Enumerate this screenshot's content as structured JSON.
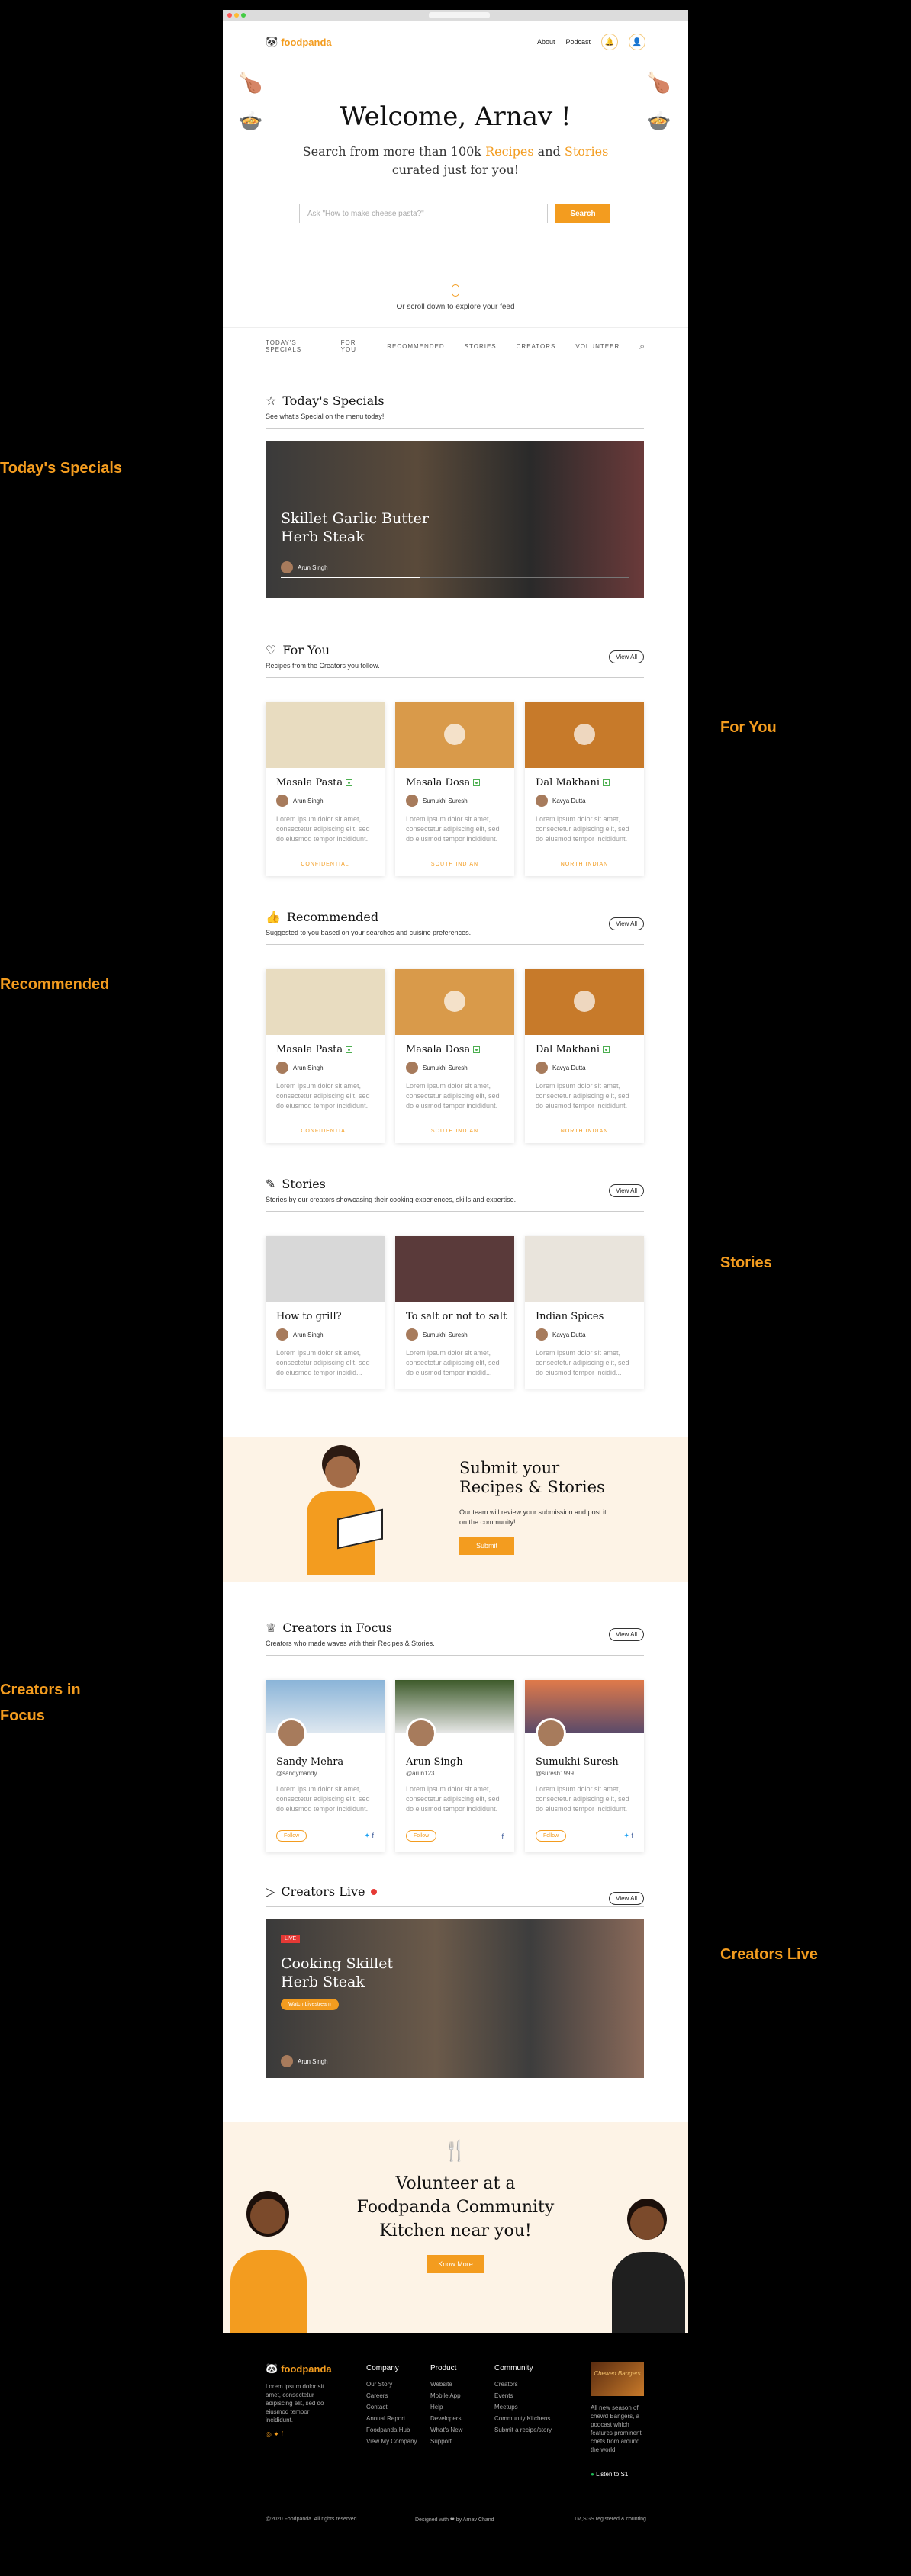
{
  "app": {
    "logo": "foodpanda",
    "nav_about": "About",
    "nav_podcast": "Podcast"
  },
  "hero": {
    "title": "Welcome, Arnav !",
    "line1_a": "Search from more than 100k ",
    "line1_b": "Recipes",
    "line1_c": " and ",
    "line1_d": "Stories",
    "line2": "curated just for you!",
    "search_placeholder": "Ask \"How to make cheese pasta?\"",
    "search_button": "Search",
    "scroll_hint": "Or scroll down to explore your feed"
  },
  "tabs": [
    "TODAY'S SPECIALS",
    "FOR YOU",
    "RECOMMENDED",
    "STORIES",
    "CREATORS",
    "VOLUNTEER"
  ],
  "specials": {
    "title": "Today's Specials",
    "subtitle": "See what's Special on the menu today!",
    "dish_line1": "Skillet Garlic Butter",
    "dish_line2": "Herb Steak",
    "author": "Arun Singh"
  },
  "view_all": "View All",
  "foryou": {
    "title": "For You",
    "subtitle": "Recipes from the Creators you follow.",
    "cards": [
      {
        "title": "Masala Pasta",
        "author": "Arun Singh",
        "desc": "Lorem ipsum dolor sit amet, consectetur adipiscing elit, sed do eiusmod tempor incididunt.",
        "tag": "CONFIDENTIAL"
      },
      {
        "title": "Masala Dosa",
        "author": "Sumukhi Suresh",
        "desc": "Lorem ipsum dolor sit amet, consectetur adipiscing elit, sed do eiusmod tempor incididunt.",
        "tag": "SOUTH INDIAN"
      },
      {
        "title": "Dal Makhani",
        "author": "Kavya Dutta",
        "desc": "Lorem ipsum dolor sit amet, consectetur adipiscing elit, sed do eiusmod tempor incididunt.",
        "tag": "NORTH INDIAN"
      }
    ]
  },
  "recommended": {
    "title": "Recommended",
    "subtitle": "Suggested to you based on your searches and cuisine preferences.",
    "cards": [
      {
        "title": "Masala Pasta",
        "author": "Arun Singh",
        "desc": "Lorem ipsum dolor sit amet, consectetur adipiscing elit, sed do eiusmod tempor incididunt.",
        "tag": "CONFIDENTIAL"
      },
      {
        "title": "Masala Dosa",
        "author": "Sumukhi Suresh",
        "desc": "Lorem ipsum dolor sit amet, consectetur adipiscing elit, sed do eiusmod tempor incididunt.",
        "tag": "SOUTH INDIAN"
      },
      {
        "title": "Dal Makhani",
        "author": "Kavya Dutta",
        "desc": "Lorem ipsum dolor sit amet, consectetur adipiscing elit, sed do eiusmod tempor incididunt.",
        "tag": "NORTH INDIAN"
      }
    ]
  },
  "stories": {
    "title": "Stories",
    "subtitle": "Stories by our creators showcasing their cooking experiences, skills and expertise.",
    "cards": [
      {
        "title": "How to grill?",
        "author": "Arun Singh",
        "desc": "Lorem ipsum dolor sit amet, consectetur adipiscing elit, sed do eiusmod tempor incidid..."
      },
      {
        "title": "To salt or not to salt",
        "author": "Sumukhi Suresh",
        "desc": "Lorem ipsum dolor sit amet, consectetur adipiscing elit, sed do eiusmod tempor incidid..."
      },
      {
        "title": "Indian Spices",
        "author": "Kavya Dutta",
        "desc": "Lorem ipsum dolor sit amet, consectetur adipiscing elit, sed do eiusmod tempor incidid..."
      }
    ]
  },
  "submit": {
    "title1": "Submit your",
    "title2": "Recipes & Stories",
    "desc": "Our team will review your submission and post it on the community!",
    "button": "Submit"
  },
  "creators": {
    "title": "Creators in Focus",
    "subtitle": "Creators who made waves with their Recipes & Stories.",
    "follow": "Follow",
    "cards": [
      {
        "name": "Sandy Mehra",
        "handle": "@sandymandy",
        "desc": "Lorem ipsum dolor sit amet, consectetur adipiscing elit, sed do eiusmod tempor incididunt."
      },
      {
        "name": "Arun Singh",
        "handle": "@arun123",
        "desc": "Lorem ipsum dolor sit amet, consectetur adipiscing elit, sed do eiusmod tempor incididunt."
      },
      {
        "name": "Sumukhi Suresh",
        "handle": "@suresh1999",
        "desc": "Lorem ipsum dolor sit amet, consectetur adipiscing elit, sed do eiusmod tempor incididunt."
      }
    ]
  },
  "live": {
    "title": "Creators Live",
    "badge": "LIVE",
    "dish_line1": "Cooking Skillet",
    "dish_line2": "Herb Steak",
    "button": "Watch Livestream",
    "author": "Arun Singh"
  },
  "volunteer": {
    "line1": "Volunteer at a",
    "line2": "Foodpanda Community",
    "line3": "Kitchen near you!",
    "button": "Know More"
  },
  "footer": {
    "about": "Lorem ipsum dolor sit amet, consectetur adipiscing elit, sed do eiusmod tempor incididunt.",
    "company": {
      "title": "Company",
      "items": [
        "Our Story",
        "Careers",
        "Contact",
        "Annual Report",
        "Foodpanda Hub",
        "View My Company"
      ]
    },
    "product": {
      "title": "Product",
      "items": [
        "Website",
        "Mobile App",
        "Help",
        "Developers",
        "What's New",
        "Support"
      ]
    },
    "community": {
      "title": "Community",
      "items": [
        "Creators",
        "Events",
        "Meetups",
        "Community Kitchens",
        "Submit a recipe/story"
      ]
    },
    "podcast_title": "Chewed Bangers",
    "podcast_desc": "All new season of chewd Bangers, a podcast which features prominent chefs from around the world.",
    "listen": "Listen to S1",
    "copyright": "@2020 Foodpanda. All rights reserved.",
    "designed": "Designed with ❤ by Arnav Chand",
    "address": "TM,SGS registered & counting"
  },
  "side_labels": {
    "specials": "Today's Specials",
    "foryou": "For You",
    "recommended": "Recommended",
    "stories": "Stories",
    "creators1": "Creators in",
    "creators2": "Focus",
    "live": "Creators Live"
  }
}
